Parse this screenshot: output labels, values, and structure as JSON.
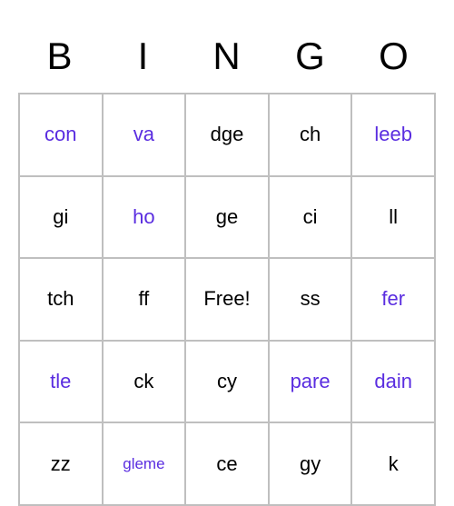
{
  "headers": [
    "B",
    "I",
    "N",
    "G",
    "O"
  ],
  "cells": [
    [
      {
        "text": "con",
        "highlight": true
      },
      {
        "text": "va",
        "highlight": true
      },
      {
        "text": "dge",
        "highlight": false
      },
      {
        "text": "ch",
        "highlight": false
      },
      {
        "text": "leeb",
        "highlight": true
      }
    ],
    [
      {
        "text": "gi",
        "highlight": false
      },
      {
        "text": "ho",
        "highlight": true
      },
      {
        "text": "ge",
        "highlight": false
      },
      {
        "text": "ci",
        "highlight": false
      },
      {
        "text": "ll",
        "highlight": false
      }
    ],
    [
      {
        "text": "tch",
        "highlight": false
      },
      {
        "text": "ff",
        "highlight": false
      },
      {
        "text": "Free!",
        "highlight": false
      },
      {
        "text": "ss",
        "highlight": false
      },
      {
        "text": "fer",
        "highlight": true
      }
    ],
    [
      {
        "text": "tle",
        "highlight": true
      },
      {
        "text": "ck",
        "highlight": false
      },
      {
        "text": "cy",
        "highlight": false
      },
      {
        "text": "pare",
        "highlight": true
      },
      {
        "text": "dain",
        "highlight": true
      }
    ],
    [
      {
        "text": "zz",
        "highlight": false
      },
      {
        "text": "gleme",
        "highlight": true,
        "small": true
      },
      {
        "text": "ce",
        "highlight": false
      },
      {
        "text": "gy",
        "highlight": false
      },
      {
        "text": "k",
        "highlight": false
      }
    ]
  ]
}
